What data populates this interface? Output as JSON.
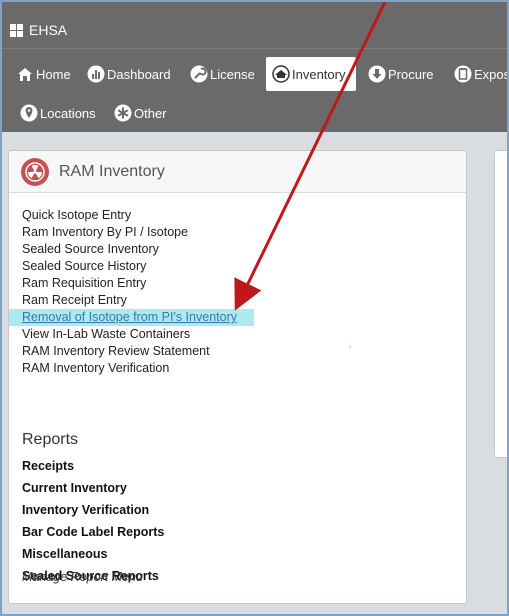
{
  "app": {
    "title": "EHSA"
  },
  "nav": {
    "items": [
      {
        "label": "Home",
        "icon": "home-icon"
      },
      {
        "label": "Dashboard",
        "icon": "dashboard-icon"
      },
      {
        "label": "License",
        "icon": "wrench-icon"
      },
      {
        "label": "Inventory",
        "icon": "inventory-icon",
        "active": true
      },
      {
        "label": "Procure",
        "icon": "download-icon"
      },
      {
        "label": "Expos",
        "icon": "clipboard-icon"
      },
      {
        "label": "Locations",
        "icon": "location-pin-icon"
      },
      {
        "label": "Other",
        "icon": "asterisk-icon"
      }
    ]
  },
  "panel": {
    "title": "RAM Inventory",
    "icon": "radiation-icon",
    "links": [
      "Quick Isotope Entry",
      "Ram Inventory By PI / Isotope",
      "Sealed Source Inventory",
      "Sealed Source History",
      "Ram Requisition Entry",
      "Ram Receipt Entry",
      "Removal of Isotope from PI's Inventory",
      "View In-Lab Waste Containers",
      "RAM Inventory Review Statement",
      "RAM Inventory Verification"
    ],
    "reports_title": "Reports",
    "reports": [
      "Receipts",
      "Current Inventory",
      "Inventory Verification",
      "Bar Code Label Reports",
      "Miscellaneous",
      "Sealed Source Reports"
    ],
    "manage_label": "Manage Report Menu"
  },
  "colors": {
    "topbar": "#6a6a6a",
    "highlight": "#aee9ee",
    "link_active": "#2f7da8",
    "arrow": "#c0181a"
  }
}
